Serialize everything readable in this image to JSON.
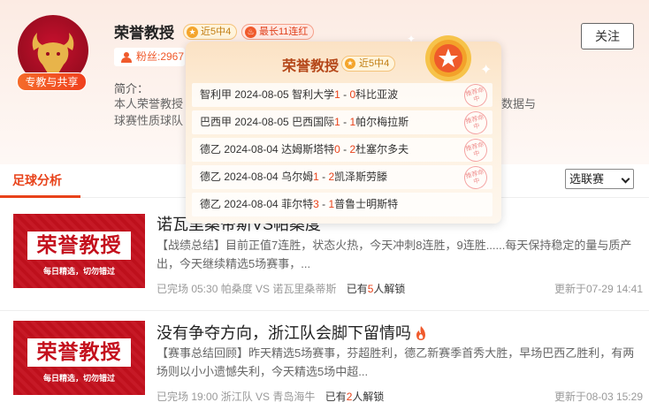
{
  "expert": {
    "name": "荣誉教授",
    "avatar_badge": "专教与共享",
    "tags": [
      "近5中4",
      "最长11连红"
    ],
    "fans_label": "粉丝:2967",
    "follow_label": "关注",
    "intro_label": "简介：",
    "intro_text": "本人荣誉教授",
    "intro_text_2": "球赛性质球队",
    "intro_right": "数据与"
  },
  "tabs": {
    "active": "足球分析",
    "select_value": "选联赛"
  },
  "popup": {
    "name": "荣誉教授",
    "tag": "近5中4",
    "stamp_text": "推荐命中",
    "matches": [
      {
        "league": "智利甲",
        "date": "2024-08-05",
        "home": "智利大学",
        "home_score": "1",
        "sep": " - ",
        "away_score": "0",
        "away": "科比亚波",
        "hit": true
      },
      {
        "league": "巴西甲",
        "date": "2024-08-05",
        "home": "巴西国际",
        "home_score": "1",
        "sep": " - ",
        "away_score": "1",
        "away": "帕尔梅拉斯",
        "hit": true
      },
      {
        "league": "德乙",
        "date": "2024-08-04",
        "home": "达姆斯塔特",
        "home_score": "0",
        "sep": " - ",
        "away_score": "2",
        "away": "杜塞尔多夫",
        "hit": true
      },
      {
        "league": "德乙",
        "date": "2024-08-04",
        "home": "乌尔姆",
        "home_score": "1",
        "sep": " - ",
        "away_score": "2",
        "away": "凯泽斯劳滕",
        "hit": true
      },
      {
        "league": "德乙",
        "date": "2024-08-04",
        "home": "菲尔特",
        "home_score": "3",
        "sep": " - ",
        "away_score": "1",
        "away": "普鲁士明斯特",
        "hit": false
      }
    ]
  },
  "articles": [
    {
      "thumb_title": "荣誉教授",
      "thumb_sub": "每日精选，切勿错过",
      "title": "诺瓦里桑帝斯VS帕桑度",
      "desc": "【战绩总结】目前正值7连胜，状态火热，今天冲刺8连胜，9连胜......每天保持稳定的量与质产出，今天继续精选5场赛事，...",
      "meta": "已完场 05:30 帕桑度 VS 诺瓦里桑蒂斯",
      "unlock_pre": "已有",
      "unlock_count": "5",
      "unlock_post": "人解锁",
      "time": "更新于07-29 14:41"
    },
    {
      "thumb_title": "荣誉教授",
      "thumb_sub": "每日精选，切勿错过",
      "title": "没有争夺方向，浙江队会脚下留情吗",
      "desc": "【赛事总结回顾】昨天精选5场赛事，芬超胜利，德乙新赛季首秀大胜，早场巴西乙胜利，有两场则以小小遗憾失利，今天精选5场中超...",
      "meta": "已完场 19:00 浙江队 VS 青岛海牛",
      "unlock_pre": "已有",
      "unlock_count": "2",
      "unlock_post": "人解锁",
      "time": "更新于08-03 15:29"
    }
  ],
  "colors": {
    "accent": "#e8421a",
    "thumb_red": "#c4101d"
  }
}
